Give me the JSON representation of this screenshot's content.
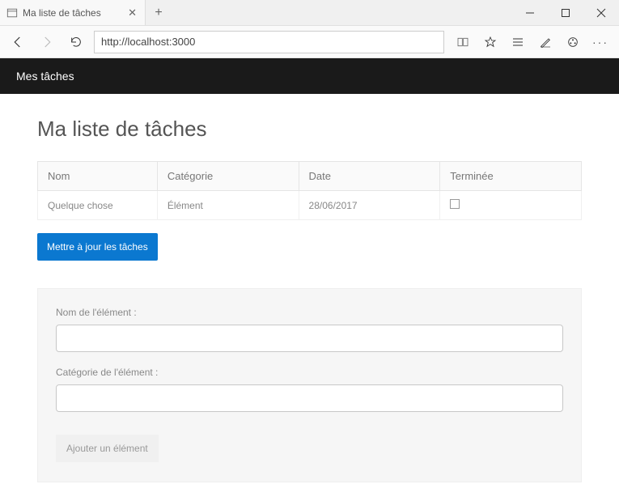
{
  "browser": {
    "tab_title": "Ma liste de tâches",
    "url": "http://localhost:3000"
  },
  "appbar": {
    "brand": "Mes tâches"
  },
  "page": {
    "title": "Ma liste de tâches"
  },
  "table": {
    "headers": {
      "name": "Nom",
      "category": "Catégorie",
      "date": "Date",
      "done": "Terminée"
    },
    "rows": [
      {
        "name": "Quelque chose",
        "category": "Élément",
        "date": "28/06/2017",
        "done": false
      }
    ]
  },
  "buttons": {
    "update": "Mettre à jour les tâches",
    "add": "Ajouter un élément"
  },
  "form": {
    "name_label": "Nom de l'élément :",
    "category_label": "Catégorie de l'élément :",
    "name_value": "",
    "category_value": ""
  }
}
